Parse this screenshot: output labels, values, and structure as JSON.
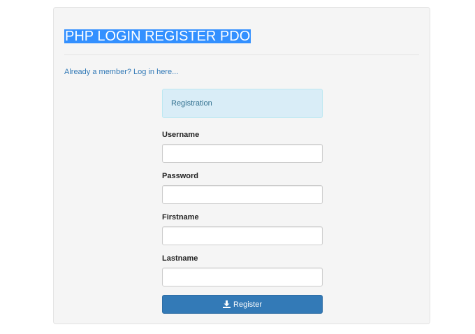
{
  "header": {
    "title": "PHP LOGIN REGISTER PDO"
  },
  "links": {
    "member": "Already a member? Log in here..."
  },
  "alert": {
    "text": "Registration"
  },
  "form": {
    "username_label": "Username",
    "password_label": "Password",
    "firstname_label": "Firstname",
    "lastname_label": "Lastname",
    "username_value": "",
    "password_value": "",
    "firstname_value": "",
    "lastname_value": ""
  },
  "button": {
    "label": "Register",
    "icon": "download-icon"
  },
  "colors": {
    "primary": "#337ab7",
    "alert_bg": "#d9edf7",
    "title_highlight": "#3390ff"
  }
}
